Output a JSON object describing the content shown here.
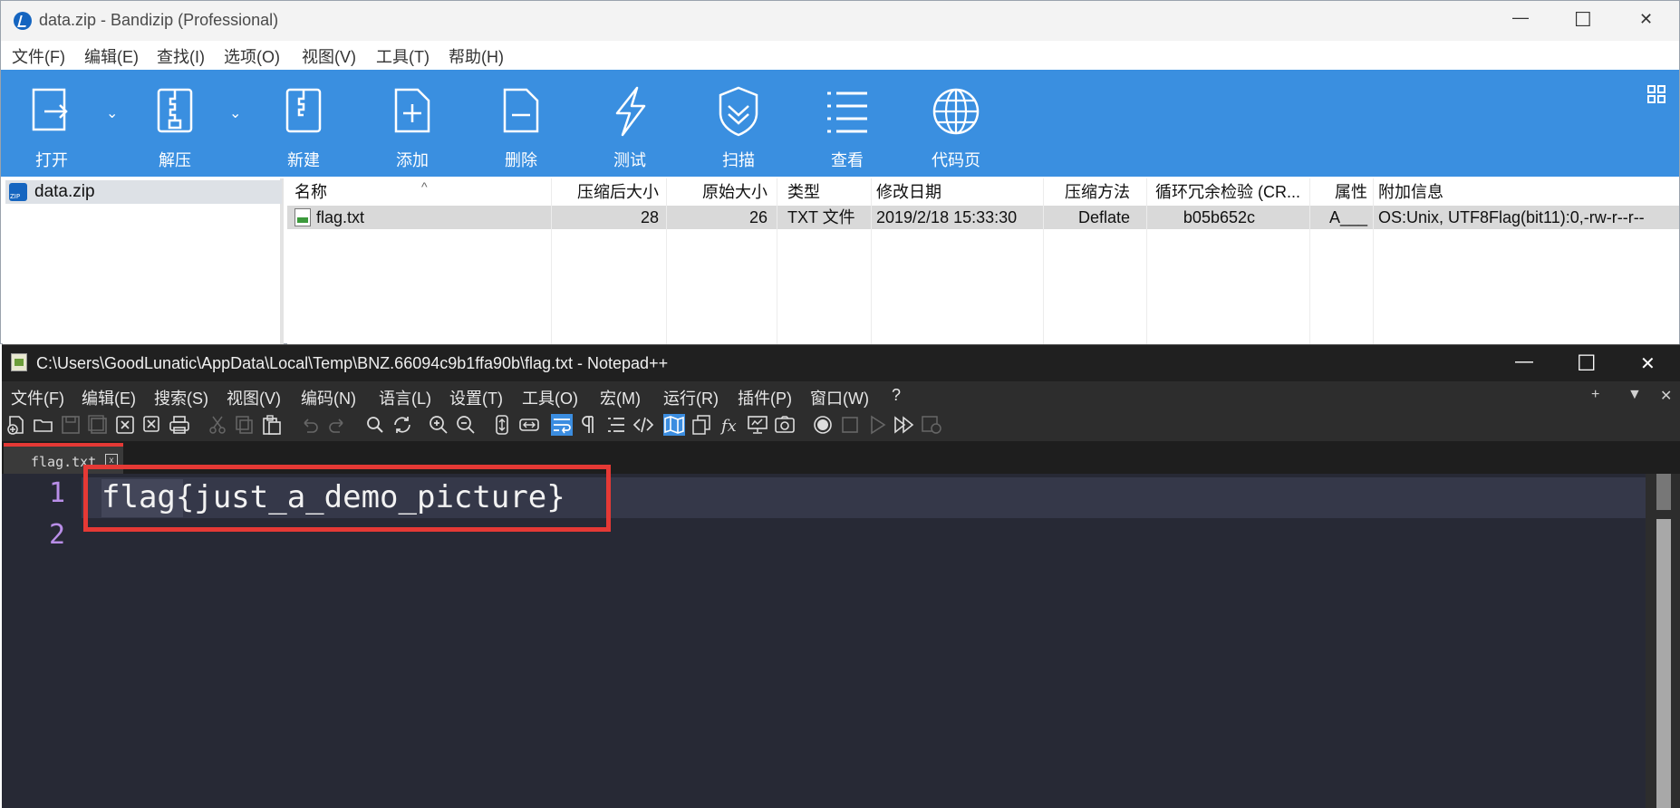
{
  "bandizip": {
    "title": "data.zip - Bandizip (Professional)",
    "window_controls": {
      "minimize": "—",
      "maximize": "☐",
      "close": "✕"
    },
    "menu": [
      "文件(F)",
      "编辑(E)",
      "查找(I)",
      "选项(O)",
      "视图(V)",
      "工具(T)",
      "帮助(H)"
    ],
    "toolbar": [
      {
        "label": "打开",
        "icon": "open-icon"
      },
      {
        "label": "解压",
        "icon": "extract-icon"
      },
      {
        "label": "新建",
        "icon": "new-archive-icon"
      },
      {
        "label": "添加",
        "icon": "add-icon"
      },
      {
        "label": "删除",
        "icon": "delete-icon"
      },
      {
        "label": "测试",
        "icon": "test-icon"
      },
      {
        "label": "扫描",
        "icon": "scan-icon"
      },
      {
        "label": "查看",
        "icon": "view-icon"
      },
      {
        "label": "代码页",
        "icon": "codepage-icon"
      }
    ],
    "tree": {
      "item": "data.zip"
    },
    "columns": [
      "名称",
      "压缩后大小",
      "原始大小",
      "类型",
      "修改日期",
      "压缩方法",
      "循环冗余检验 (CR...",
      "属性",
      "附加信息"
    ],
    "rows": [
      {
        "name": "flag.txt",
        "packed": "28",
        "size": "26",
        "type": "TXT 文件",
        "modified": "2019/2/18 15:33:30",
        "method": "Deflate",
        "crc": "b05b652c",
        "attr": "A___",
        "extra": "OS:Unix, UTF8Flag(bit11):0,-rw-r--r--"
      }
    ],
    "colors": {
      "toolbar": "#3a8fe0",
      "selection": "#d9d9d9"
    }
  },
  "notepad": {
    "title": "C:\\Users\\GoodLunatic\\AppData\\Local\\Temp\\BNZ.66094c9b1ffa90b\\flag.txt - Notepad++",
    "window_controls": {
      "minimize": "—",
      "maximize": "☐",
      "close": "✕"
    },
    "menu": [
      "文件(F)",
      "编辑(E)",
      "搜索(S)",
      "视图(V)",
      "编码(N)",
      "语言(L)",
      "设置(T)",
      "工具(O)",
      "宏(M)",
      "运行(R)",
      "插件(P)",
      "窗口(W)",
      "?"
    ],
    "menu_right": {
      "plus": "+",
      "down": "▼",
      "close": "✕"
    },
    "tab": {
      "label": "flag.txt",
      "close": "x"
    },
    "lines": [
      {
        "num": "1",
        "text": "flag{just_a_demo_picture}"
      },
      {
        "num": "2",
        "text": ""
      }
    ],
    "colors": {
      "editor_bg": "#272935",
      "line_numbers": "#b98ee8",
      "highlight_box": "#e53935"
    }
  }
}
